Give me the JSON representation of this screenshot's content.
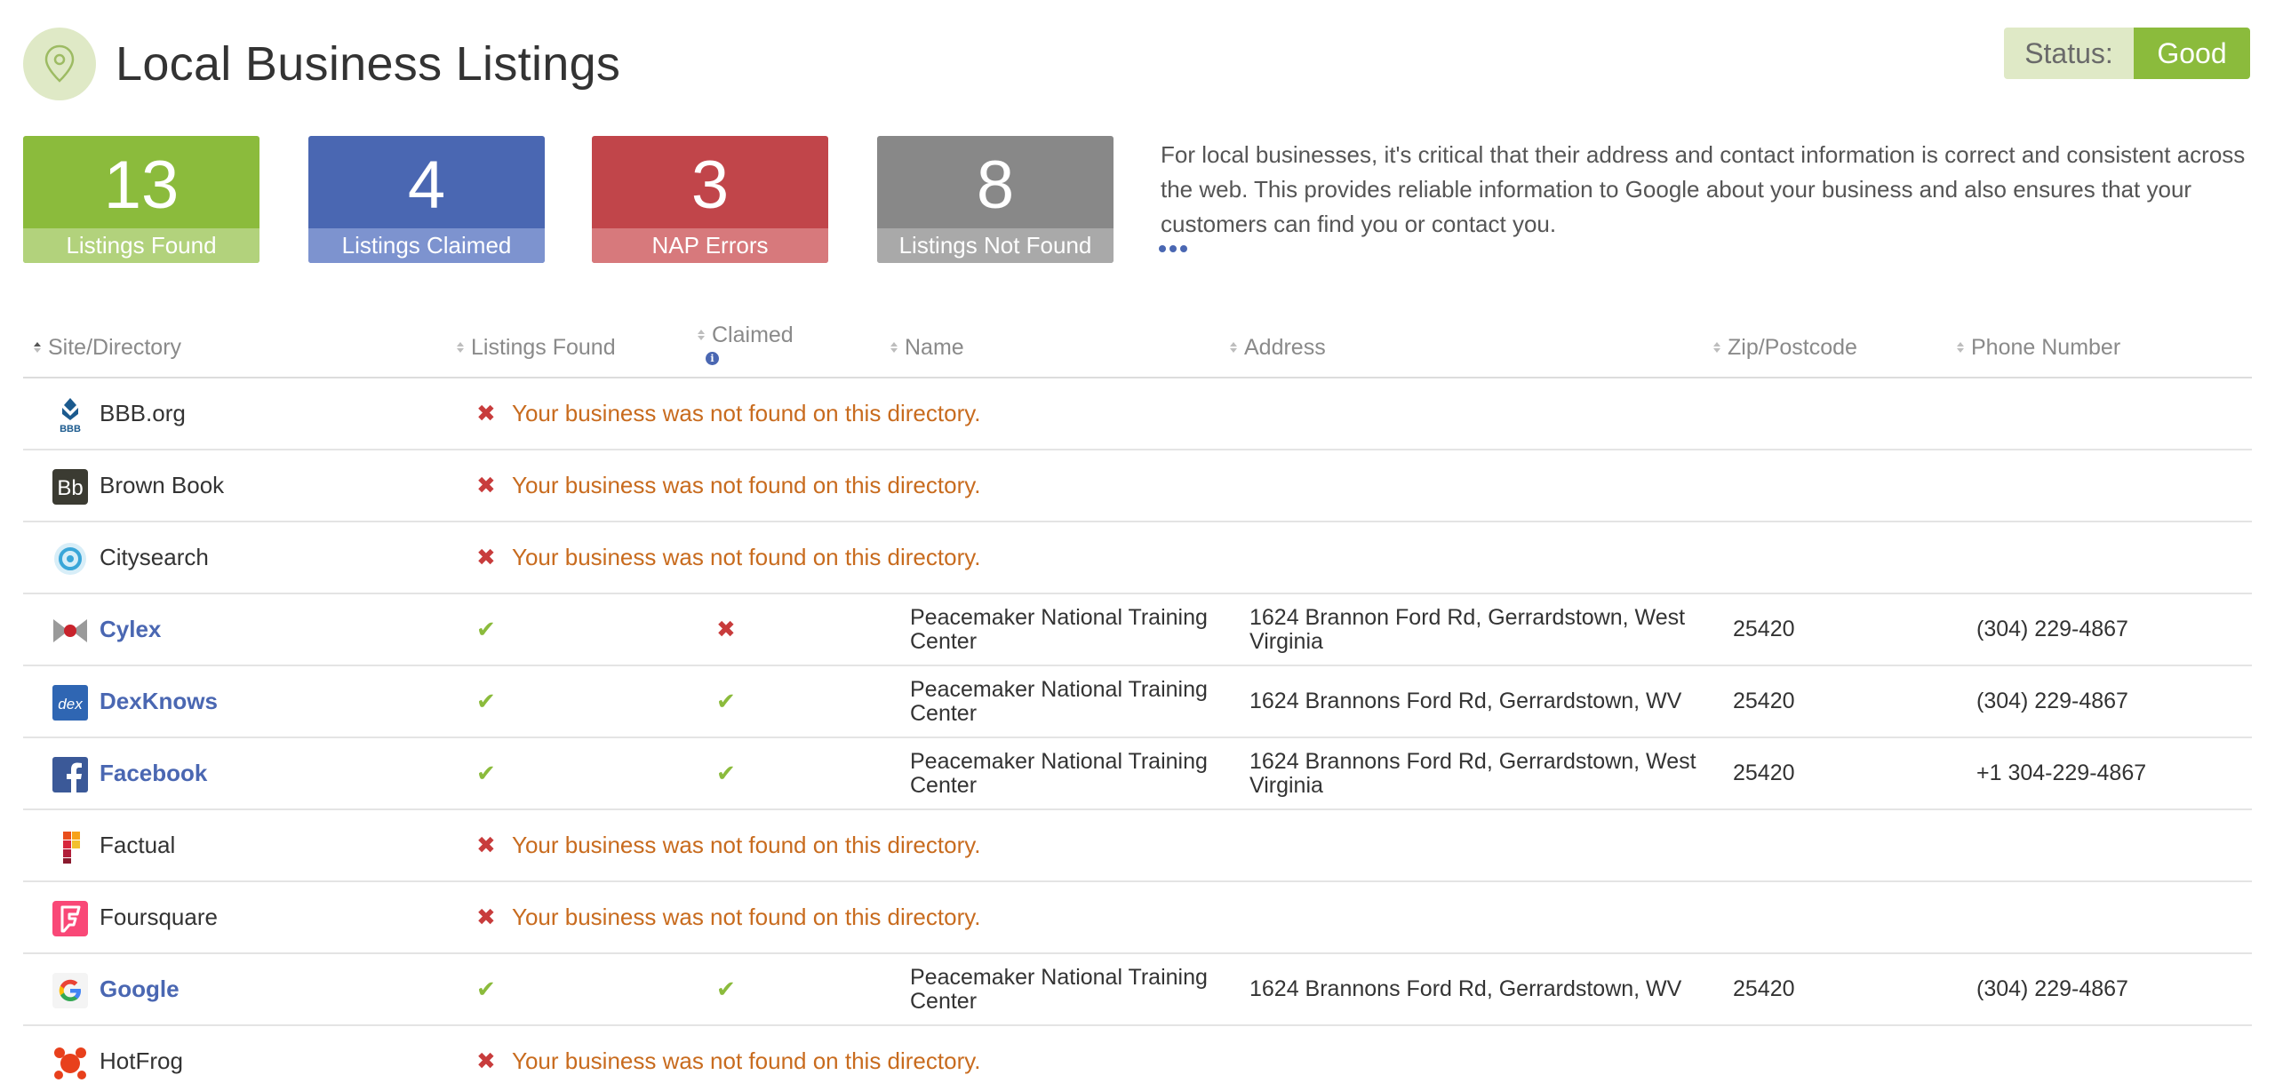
{
  "header": {
    "title": "Local Business Listings"
  },
  "status": {
    "label": "Status:",
    "value": "Good"
  },
  "stats": [
    {
      "value": "13",
      "label": "Listings Found"
    },
    {
      "value": "4",
      "label": "Listings Claimed"
    },
    {
      "value": "3",
      "label": "NAP Errors"
    },
    {
      "value": "8",
      "label": "Listings Not Found"
    }
  ],
  "description": "For local businesses, it's critical that their address and contact information is correct and consistent across the web. This provides reliable information to Google about your business and also ensures that your customers can find you or contact you.",
  "columns": {
    "site": "Site/Directory",
    "found": "Listings Found",
    "claimed": "Claimed",
    "name": "Name",
    "address": "Address",
    "zip": "Zip/Postcode",
    "phone": "Phone Number"
  },
  "not_found_message": "Your business was not found on this directory.",
  "rows": [
    {
      "site": "BBB.org",
      "icon": "bbb-logo-icon"
    },
    {
      "site": "Brown Book",
      "icon": "brownbook-logo-icon"
    },
    {
      "site": "Citysearch",
      "icon": "citysearch-logo-icon"
    },
    {
      "site": "Cylex",
      "icon": "cylex-logo-icon",
      "name": "Peacemaker National Training Center",
      "address": "1624 Brannon Ford Rd, Gerrardstown, West Virginia",
      "zip": "25420",
      "phone": "(304) 229-4867"
    },
    {
      "site": "DexKnows",
      "icon": "dex-logo-icon",
      "name": "Peacemaker National Training Center",
      "address": "1624 Brannons Ford Rd, Gerrardstown, WV",
      "zip": "25420",
      "phone": "(304) 229-4867"
    },
    {
      "site": "Facebook",
      "icon": "facebook-logo-icon",
      "name": "Peacemaker National Training Center",
      "address": "1624 Brannons Ford Rd, Gerrardstown, West Virginia",
      "zip": "25420",
      "phone": "+1 304-229-4867"
    },
    {
      "site": "Factual",
      "icon": "factual-logo-icon"
    },
    {
      "site": "Foursquare",
      "icon": "foursquare-logo-icon"
    },
    {
      "site": "Google",
      "icon": "google-logo-icon",
      "name": "Peacemaker National Training Center",
      "address": "1624 Brannons Ford Rd, Gerrardstown, WV",
      "zip": "25420",
      "phone": "(304) 229-4867"
    },
    {
      "site": "HotFrog",
      "icon": "hotfrog-logo-icon"
    }
  ],
  "colors": {
    "green": "#8bbb3c",
    "blue": "#4a67b2",
    "red": "#c1454a",
    "gray": "#888888",
    "orange": "#c86b1e"
  }
}
